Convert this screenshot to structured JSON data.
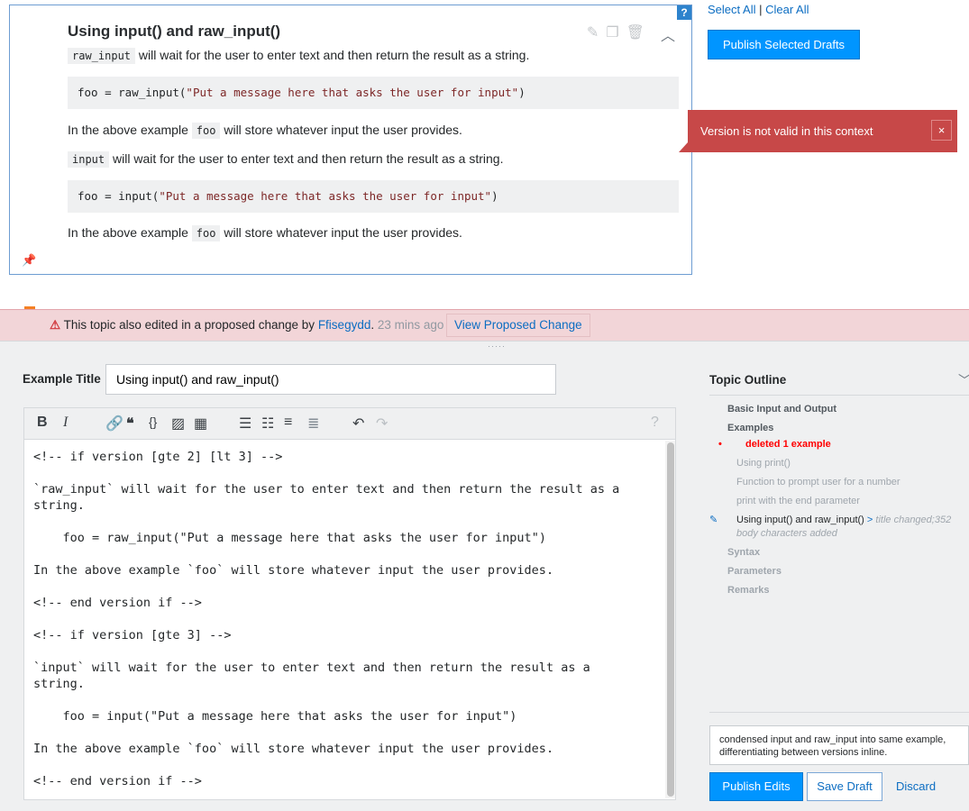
{
  "card": {
    "help": "?",
    "title": "Using input() and raw_input()",
    "p1_code": "raw_input",
    "p1": " will wait for the user to enter text and then return the result as a string.",
    "pre1_a": "foo = raw_input(",
    "pre1_s": "\"Put a message here that asks the user for input\"",
    "pre1_b": ")",
    "p2_a": "In the above example ",
    "p2_code": "foo",
    "p2_b": " will store whatever input the user provides.",
    "p3_code": "input",
    "p3": " will wait for the user to enter text and then return the result as a string.",
    "pre2_a": "foo = input(",
    "pre2_s": "\"Put a message here that asks the user for input\"",
    "pre2_b": ")",
    "p4_a": "In the above example ",
    "p4_code": "foo",
    "p4_b": " will store whatever input the user provides."
  },
  "selection": {
    "select_all": "Select All",
    "sep": " | ",
    "clear_all": "Clear All",
    "publish_selected": "Publish Selected Drafts"
  },
  "error": {
    "message": "Version is not valid in this context",
    "close": "×"
  },
  "banner": {
    "text": "This topic also edited in a proposed change by ",
    "user": "Ffisegydd",
    "dot": ". ",
    "ago": "23 mins ago",
    "button": "View Proposed Change"
  },
  "editor": {
    "title_label": "Example Title",
    "title_value": "Using input() and raw_input()",
    "lines": [
      "<!-- if version [gte 2] [lt 3] -->",
      "",
      "`raw_input` will wait for the user to enter text and then return the result as a string.",
      "",
      "    foo = raw_input(\"Put a message here that asks the user for input\")",
      "",
      "In the above example `foo` will store whatever input the user provides.",
      "",
      "<!-- end version if -->",
      "",
      "<!-- if version [gte 3] -->",
      "",
      "`input` will wait for the user to enter text and then return the result as a string.",
      "",
      "    foo = input(\"Put a message here that asks the user for input\")",
      "",
      "In the above example `foo` will store whatever input the user provides.",
      "",
      "<!-- end version if -->"
    ]
  },
  "outline": {
    "title": "Topic Outline",
    "topic": "Basic Input and Output",
    "examples": "Examples",
    "deleted": "deleted 1 example",
    "items": [
      "Using print()",
      "Function to prompt user for a number",
      "print with the end parameter"
    ],
    "current": "Using input() and raw_input()",
    "current_sep": " > ",
    "current_note": "title changed;352",
    "current_note2": "body characters added",
    "sections": [
      "Syntax",
      "Parameters",
      "Remarks"
    ]
  },
  "footer": {
    "message": "condensed input and raw_input into same example, differentiating between versions inline.",
    "publish": "Publish Edits",
    "save": "Save Draft",
    "discard": "Discard"
  },
  "colors": {
    "accent": "#0095ff",
    "error": "#c74848",
    "banner": "#f2d5d8",
    "deleted": "#ff0000"
  }
}
